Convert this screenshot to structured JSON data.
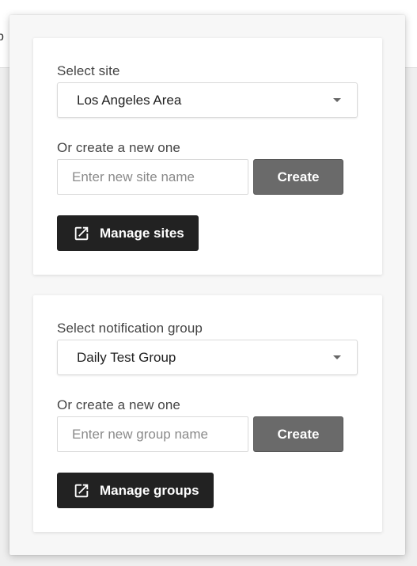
{
  "background": {
    "partial_text": "p"
  },
  "site_card": {
    "select_label": "Select site",
    "selected_value": "Los Angeles Area",
    "create_label": "Or create a new one",
    "input_placeholder": "Enter new site name",
    "create_button": "Create",
    "manage_button": "Manage sites",
    "manage_icon": "open-in-new-icon"
  },
  "group_card": {
    "select_label": "Select notification group",
    "selected_value": "Daily Test Group",
    "create_label": "Or create a new one",
    "input_placeholder": "Enter new group name",
    "create_button": "Create",
    "manage_button": "Manage groups",
    "manage_icon": "open-in-new-icon"
  },
  "colors": {
    "create_button_bg": "#6a6a6a",
    "manage_button_bg": "#222222"
  }
}
